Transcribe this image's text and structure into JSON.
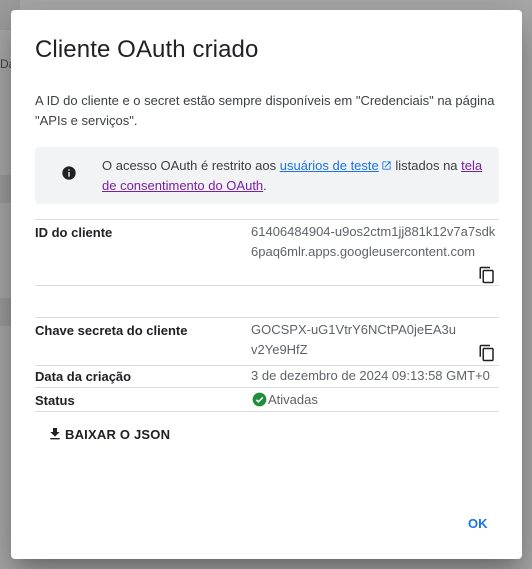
{
  "background": {
    "partial_label": "Da"
  },
  "dialog": {
    "title": "Cliente OAuth criado",
    "intro": "A ID do cliente e o secret estão sempre disponíveis em \"Credenciais\" na página \"APIs e serviços\".",
    "notice": {
      "text_before": "O acesso OAuth é restrito aos ",
      "link_test_users": "usuários de teste",
      "text_middle": " listados na ",
      "link_consent": "tela de consentimento do OAuth",
      "text_after": "."
    },
    "fields": {
      "client_id": {
        "label": "ID do cliente",
        "value": "61406484904-u9os2ctm1jj881k12v7a7sdk6paq6mlr.apps.googleusercontent.com"
      },
      "client_secret": {
        "label": "Chave secreta do cliente",
        "value": "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"
      },
      "created": {
        "label": "Data da criação",
        "value": "3 de dezembro de 2024 09:13:58 GMT+0"
      },
      "status": {
        "label": "Status",
        "value": "Ativadas"
      }
    },
    "download_label": "BAIXAR O JSON",
    "ok_label": "OK"
  },
  "colors": {
    "accent": "#1a73e8",
    "success": "#1e8e3e",
    "visited_link": "#7b1fa2"
  },
  "icons": [
    "info-icon",
    "open-in-new-icon",
    "copy-icon",
    "check-circle-icon",
    "download-icon"
  ]
}
